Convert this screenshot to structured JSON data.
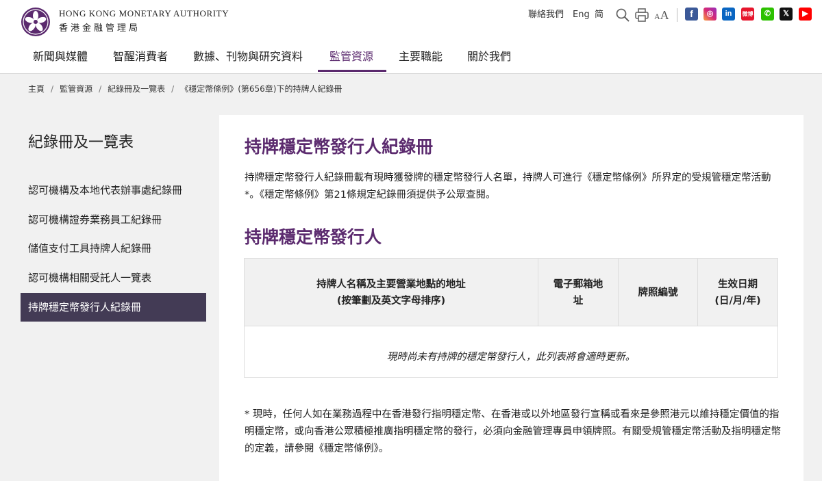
{
  "header": {
    "org_name_en": "HONG KONG MONETARY AUTHORITY",
    "org_name_zh": "香港金融管理局",
    "contact_label": "聯絡我們",
    "lang_en_label": "Eng",
    "lang_sc_label": "简",
    "font_size_label": "A",
    "font_size_small_label": "A"
  },
  "social": {
    "fb": "f",
    "ig": "◎",
    "in": "in",
    "weibo": "微博",
    "wechat": "✆",
    "x": "𝕏",
    "yt": "▶"
  },
  "nav": {
    "items": [
      {
        "label": "新聞與媒體"
      },
      {
        "label": "智醒消費者"
      },
      {
        "label": "數據、刊物與研究資料"
      },
      {
        "label": "監管資源"
      },
      {
        "label": "主要職能"
      },
      {
        "label": "關於我們"
      }
    ]
  },
  "breadcrumb": {
    "items": [
      "主頁",
      "監管資源",
      "紀錄冊及一覽表",
      "《穩定幣條例》(第656章)下的持牌人紀錄冊"
    ],
    "separator": "/"
  },
  "sidebar": {
    "title": "紀錄冊及一覽表",
    "items": [
      {
        "label": "認可機構及本地代表辦事處紀錄冊"
      },
      {
        "label": "認可機構證券業務員工紀錄冊"
      },
      {
        "label": "儲值支付工具持牌人紀錄冊"
      },
      {
        "label": "認可機構相關受託人一覽表"
      },
      {
        "label": "持牌穩定幣發行人紀錄冊"
      }
    ]
  },
  "main": {
    "title": "持牌穩定幣發行人紀錄冊",
    "intro": "持牌穩定幣發行人紀錄冊載有現時獲發牌的穩定幣發行人名單，持牌人可進行《穩定幣條例》所界定的受規管穩定幣活動*。《穩定幣條例》第21條規定紀錄冊須提供予公眾查閱。",
    "section_title": "持牌穩定幣發行人",
    "table": {
      "columns": [
        {
          "line1": "持牌人名稱及主要營業地點的地址",
          "line2": "(按筆劃及英文字母排序)"
        },
        {
          "line1": "電子郵箱地",
          "line2": "址"
        },
        {
          "line1": "牌照編號",
          "line2": ""
        },
        {
          "line1": "生效日期",
          "line2": "(日/月/年)"
        }
      ],
      "empty_message": "現時尚未有持牌的穩定幣發行人，此列表將會適時更新。"
    },
    "footnote": "* 現時，任何人如在業務過程中在香港發行指明穩定幣、在香港或以外地區發行宣稱或看來是參照港元以維持穩定價值的指明穩定幣，或向香港公眾積極推廣指明穩定幣的發行，必須向金融管理專員申領牌照。有關受規管穩定幣活動及指明穩定幣的定義，請參閱《穩定幣條例》。"
  },
  "colors": {
    "brand_purple": "#5b2a6e",
    "sidebar_active_bg": "#433b55",
    "page_bg": "#f1f1f1"
  },
  "icons": [
    "hkma-bauhinia-logo",
    "search-icon",
    "print-icon",
    "font-size-icon",
    "facebook-icon",
    "instagram-icon",
    "linkedin-icon",
    "weibo-icon",
    "wechat-icon",
    "x-icon",
    "youtube-icon"
  ]
}
